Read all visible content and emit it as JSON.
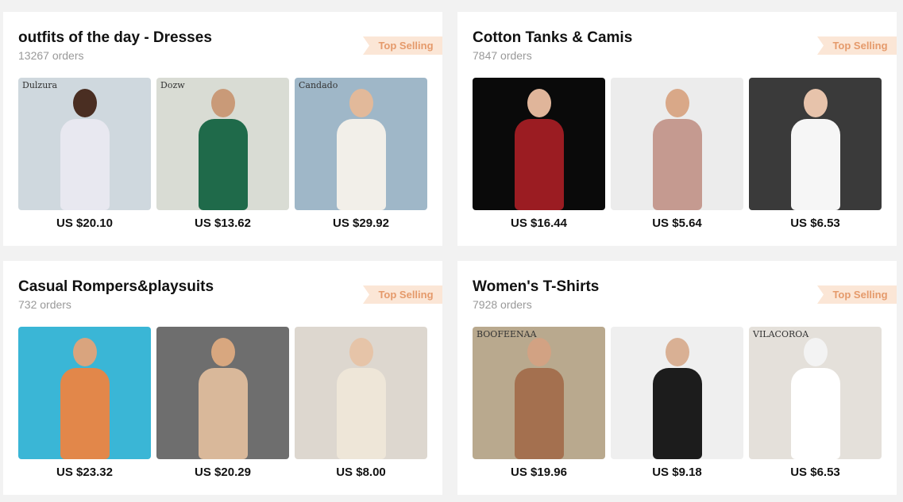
{
  "cards": [
    {
      "title": "outfits of the day - Dresses",
      "orders": "13267 orders",
      "badge": "Top Selling",
      "products": [
        {
          "price": "US $20.10",
          "brand": "Dulzura",
          "bg": "#cfd8de",
          "skin": "#4a2e22",
          "garment": "#e8e8f0"
        },
        {
          "price": "US $13.62",
          "brand": "Dozw",
          "bg": "#d9dcd4",
          "skin": "#c99a78",
          "garment": "#1f6a4a"
        },
        {
          "price": "US $29.92",
          "brand": "Candado",
          "bg": "#9fb7c8",
          "skin": "#e2b99a",
          "garment": "#f2efe9"
        }
      ]
    },
    {
      "title": "Cotton Tanks & Camis",
      "orders": "7847 orders",
      "badge": "Top Selling",
      "products": [
        {
          "price": "US $16.44",
          "brand": "",
          "bg": "#0a0a0a",
          "skin": "#e0b59a",
          "garment": "#9b1c22"
        },
        {
          "price": "US $5.64",
          "brand": "",
          "bg": "#ececec",
          "skin": "#d9a888",
          "garment": "#c59a90"
        },
        {
          "price": "US $6.53",
          "brand": "",
          "bg": "#3a3a3a",
          "skin": "#e7c3ab",
          "garment": "#f6f6f6"
        }
      ]
    },
    {
      "title": "Casual Rompers&playsuits",
      "orders": "732 orders",
      "badge": "Top Selling",
      "products": [
        {
          "price": "US $23.32",
          "brand": "",
          "bg": "#3ab6d6",
          "skin": "#d9a47e",
          "garment": "#e2874a"
        },
        {
          "price": "US $20.29",
          "brand": "",
          "bg": "#6e6e6e",
          "skin": "#d8a77f",
          "garment": "#d9b89a"
        },
        {
          "price": "US $8.00",
          "brand": "",
          "bg": "#ddd7cf",
          "skin": "#e6c4a8",
          "garment": "#eee6d8"
        }
      ]
    },
    {
      "title": "Women's T-Shirts",
      "orders": "7928 orders",
      "badge": "Top Selling",
      "products": [
        {
          "price": "US $19.96",
          "brand": "BOOFEENAA",
          "bg": "#b9a98e",
          "skin": "#d2a283",
          "garment": "#a4704f"
        },
        {
          "price": "US $9.18",
          "brand": "",
          "bg": "#efefef",
          "skin": "#d9b094",
          "garment": "#1c1c1c"
        },
        {
          "price": "US $6.53",
          "brand": "VILACOROA",
          "bg": "#e4e0da",
          "skin": "#f3f3f3",
          "garment": "#ffffff"
        }
      ]
    }
  ]
}
